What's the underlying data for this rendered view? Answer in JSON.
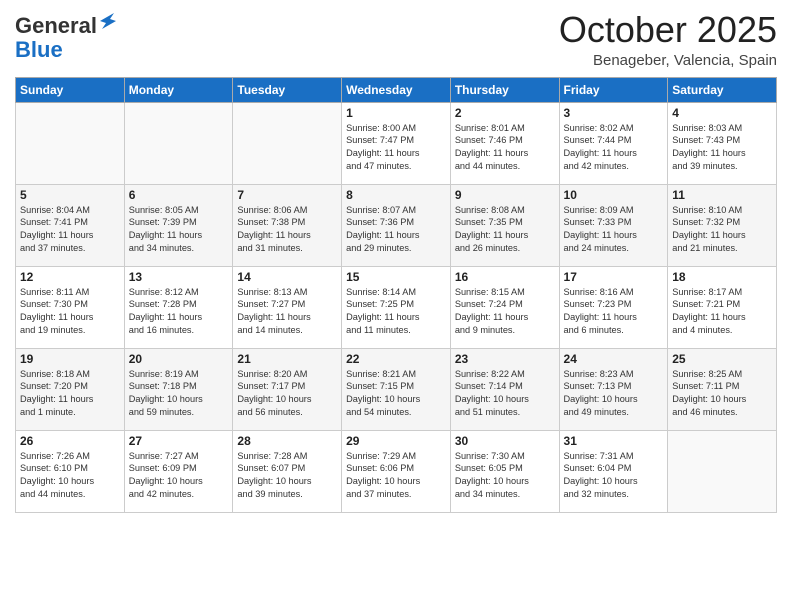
{
  "header": {
    "logo_line1": "General",
    "logo_line2": "Blue",
    "month": "October 2025",
    "location": "Benageber, Valencia, Spain"
  },
  "weekdays": [
    "Sunday",
    "Monday",
    "Tuesday",
    "Wednesday",
    "Thursday",
    "Friday",
    "Saturday"
  ],
  "weeks": [
    [
      {
        "day": "",
        "info": ""
      },
      {
        "day": "",
        "info": ""
      },
      {
        "day": "",
        "info": ""
      },
      {
        "day": "1",
        "info": "Sunrise: 8:00 AM\nSunset: 7:47 PM\nDaylight: 11 hours\nand 47 minutes."
      },
      {
        "day": "2",
        "info": "Sunrise: 8:01 AM\nSunset: 7:46 PM\nDaylight: 11 hours\nand 44 minutes."
      },
      {
        "day": "3",
        "info": "Sunrise: 8:02 AM\nSunset: 7:44 PM\nDaylight: 11 hours\nand 42 minutes."
      },
      {
        "day": "4",
        "info": "Sunrise: 8:03 AM\nSunset: 7:43 PM\nDaylight: 11 hours\nand 39 minutes."
      }
    ],
    [
      {
        "day": "5",
        "info": "Sunrise: 8:04 AM\nSunset: 7:41 PM\nDaylight: 11 hours\nand 37 minutes."
      },
      {
        "day": "6",
        "info": "Sunrise: 8:05 AM\nSunset: 7:39 PM\nDaylight: 11 hours\nand 34 minutes."
      },
      {
        "day": "7",
        "info": "Sunrise: 8:06 AM\nSunset: 7:38 PM\nDaylight: 11 hours\nand 31 minutes."
      },
      {
        "day": "8",
        "info": "Sunrise: 8:07 AM\nSunset: 7:36 PM\nDaylight: 11 hours\nand 29 minutes."
      },
      {
        "day": "9",
        "info": "Sunrise: 8:08 AM\nSunset: 7:35 PM\nDaylight: 11 hours\nand 26 minutes."
      },
      {
        "day": "10",
        "info": "Sunrise: 8:09 AM\nSunset: 7:33 PM\nDaylight: 11 hours\nand 24 minutes."
      },
      {
        "day": "11",
        "info": "Sunrise: 8:10 AM\nSunset: 7:32 PM\nDaylight: 11 hours\nand 21 minutes."
      }
    ],
    [
      {
        "day": "12",
        "info": "Sunrise: 8:11 AM\nSunset: 7:30 PM\nDaylight: 11 hours\nand 19 minutes."
      },
      {
        "day": "13",
        "info": "Sunrise: 8:12 AM\nSunset: 7:28 PM\nDaylight: 11 hours\nand 16 minutes."
      },
      {
        "day": "14",
        "info": "Sunrise: 8:13 AM\nSunset: 7:27 PM\nDaylight: 11 hours\nand 14 minutes."
      },
      {
        "day": "15",
        "info": "Sunrise: 8:14 AM\nSunset: 7:25 PM\nDaylight: 11 hours\nand 11 minutes."
      },
      {
        "day": "16",
        "info": "Sunrise: 8:15 AM\nSunset: 7:24 PM\nDaylight: 11 hours\nand 9 minutes."
      },
      {
        "day": "17",
        "info": "Sunrise: 8:16 AM\nSunset: 7:23 PM\nDaylight: 11 hours\nand 6 minutes."
      },
      {
        "day": "18",
        "info": "Sunrise: 8:17 AM\nSunset: 7:21 PM\nDaylight: 11 hours\nand 4 minutes."
      }
    ],
    [
      {
        "day": "19",
        "info": "Sunrise: 8:18 AM\nSunset: 7:20 PM\nDaylight: 11 hours\nand 1 minute."
      },
      {
        "day": "20",
        "info": "Sunrise: 8:19 AM\nSunset: 7:18 PM\nDaylight: 10 hours\nand 59 minutes."
      },
      {
        "day": "21",
        "info": "Sunrise: 8:20 AM\nSunset: 7:17 PM\nDaylight: 10 hours\nand 56 minutes."
      },
      {
        "day": "22",
        "info": "Sunrise: 8:21 AM\nSunset: 7:15 PM\nDaylight: 10 hours\nand 54 minutes."
      },
      {
        "day": "23",
        "info": "Sunrise: 8:22 AM\nSunset: 7:14 PM\nDaylight: 10 hours\nand 51 minutes."
      },
      {
        "day": "24",
        "info": "Sunrise: 8:23 AM\nSunset: 7:13 PM\nDaylight: 10 hours\nand 49 minutes."
      },
      {
        "day": "25",
        "info": "Sunrise: 8:25 AM\nSunset: 7:11 PM\nDaylight: 10 hours\nand 46 minutes."
      }
    ],
    [
      {
        "day": "26",
        "info": "Sunrise: 7:26 AM\nSunset: 6:10 PM\nDaylight: 10 hours\nand 44 minutes."
      },
      {
        "day": "27",
        "info": "Sunrise: 7:27 AM\nSunset: 6:09 PM\nDaylight: 10 hours\nand 42 minutes."
      },
      {
        "day": "28",
        "info": "Sunrise: 7:28 AM\nSunset: 6:07 PM\nDaylight: 10 hours\nand 39 minutes."
      },
      {
        "day": "29",
        "info": "Sunrise: 7:29 AM\nSunset: 6:06 PM\nDaylight: 10 hours\nand 37 minutes."
      },
      {
        "day": "30",
        "info": "Sunrise: 7:30 AM\nSunset: 6:05 PM\nDaylight: 10 hours\nand 34 minutes."
      },
      {
        "day": "31",
        "info": "Sunrise: 7:31 AM\nSunset: 6:04 PM\nDaylight: 10 hours\nand 32 minutes."
      },
      {
        "day": "",
        "info": ""
      }
    ]
  ]
}
